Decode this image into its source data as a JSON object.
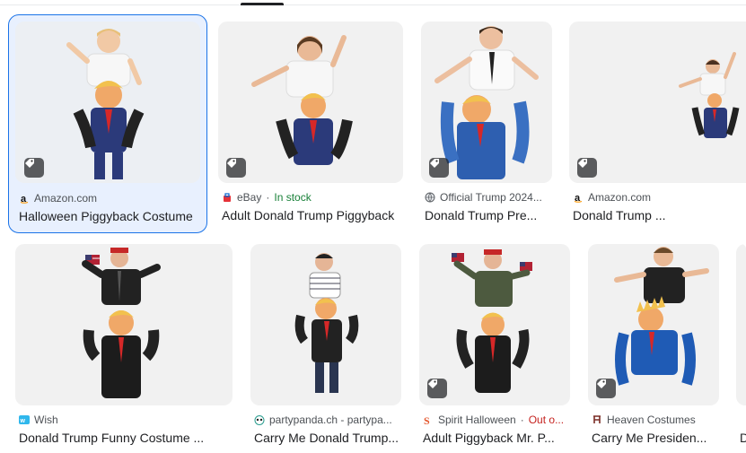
{
  "tabs_indicator": "active-tab-underline",
  "row1": [
    {
      "source": "Amazon.com",
      "title": "Halloween Piggyback Costume",
      "favicon": "amazon-icon",
      "selected": true
    },
    {
      "source": "eBay",
      "stock": "In stock",
      "title": "Adult Donald Trump Piggyback",
      "favicon": "ebay-icon"
    },
    {
      "source": "Official Trump 2024...",
      "title": "Donald Trump Pre...",
      "favicon": "globe-icon"
    },
    {
      "source": "Amazon.com",
      "title": "Donald Trump ...",
      "favicon": "amazon-icon"
    }
  ],
  "row2": [
    {
      "source": "Wish",
      "title": "Donald Trump Funny Costume ...",
      "favicon": "wish-icon"
    },
    {
      "source": "partypanda.ch - partypa...",
      "title": "Carry Me Donald Trump...",
      "favicon": "panda-icon"
    },
    {
      "source": "Spirit Halloween",
      "stock": "Out o...",
      "title": "Adult Piggyback Mr. P...",
      "favicon": "spirit-icon"
    },
    {
      "source": "Heaven Costumes",
      "title": "Carry Me Presiden...",
      "favicon": "heaven-icon"
    },
    {
      "source": "",
      "title": "D",
      "favicon": ""
    }
  ],
  "colors": {
    "selected_border": "#1a73e8",
    "selected_bg": "#e8f0fe",
    "in_stock": "#188038",
    "out_of_stock": "#c5221f"
  }
}
